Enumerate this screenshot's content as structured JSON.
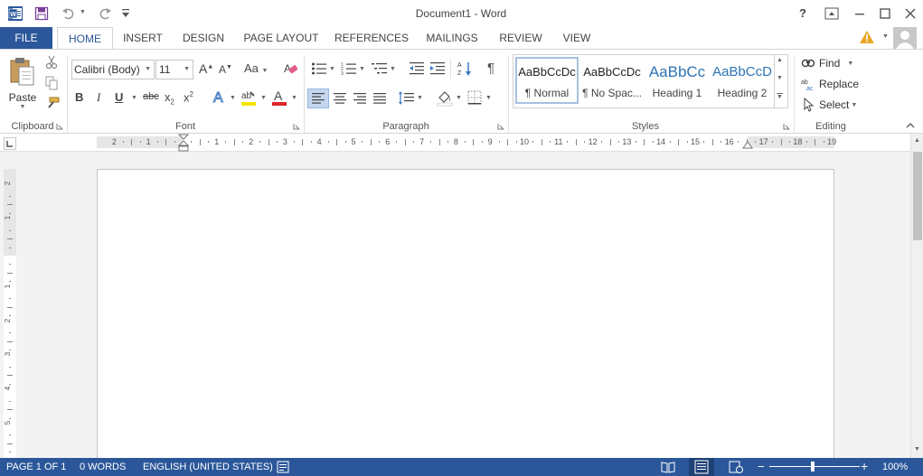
{
  "window": {
    "title": "Document1 - Word",
    "help_label": "?",
    "colors": {
      "accent": "#2b579a",
      "file_tab": "#2b579a",
      "status_bar": "#2b579a"
    }
  },
  "tabs": [
    {
      "label": "FILE",
      "active": false
    },
    {
      "label": "HOME",
      "active": true
    },
    {
      "label": "INSERT",
      "active": false
    },
    {
      "label": "DESIGN",
      "active": false
    },
    {
      "label": "PAGE LAYOUT",
      "active": false
    },
    {
      "label": "REFERENCES",
      "active": false
    },
    {
      "label": "MAILINGS",
      "active": false
    },
    {
      "label": "REVIEW",
      "active": false
    },
    {
      "label": "VIEW",
      "active": false
    }
  ],
  "ribbon": {
    "clipboard": {
      "label": "Clipboard",
      "paste_label": "Paste"
    },
    "font": {
      "label": "Font",
      "font_name": "Calibri (Body)",
      "font_size": "11",
      "bold": "B",
      "italic": "I",
      "underline": "U",
      "strikethrough": "abc",
      "change_case": "Aa"
    },
    "paragraph": {
      "label": "Paragraph"
    },
    "styles": {
      "label": "Styles",
      "items": [
        {
          "preview": "AaBbCcDc",
          "name": "¶ Normal",
          "selected": true
        },
        {
          "preview": "AaBbCcDc",
          "name": "¶ No Spac...",
          "selected": false
        },
        {
          "preview": "AaBbCc",
          "name": "Heading 1",
          "selected": false
        },
        {
          "preview": "AaBbCcD",
          "name": "Heading 2",
          "selected": false
        }
      ]
    },
    "editing": {
      "label": "Editing",
      "find_label": "Find",
      "replace_label": "Replace",
      "select_label": "Select"
    }
  },
  "ruler": {
    "horizontal_ticks": [
      "2",
      "1",
      "1",
      "2",
      "3",
      "4",
      "5",
      "6",
      "7",
      "8",
      "9",
      "10",
      "11",
      "12",
      "13",
      "14",
      "15",
      "16",
      "17",
      "18",
      "19"
    ],
    "vertical_ticks": [
      "2",
      "1",
      "1",
      "2",
      "3",
      "4",
      "5"
    ]
  },
  "status_bar": {
    "page": "PAGE 1 OF 1",
    "words": "0 WORDS",
    "language": "ENGLISH (UNITED STATES)",
    "zoom": "100%"
  }
}
